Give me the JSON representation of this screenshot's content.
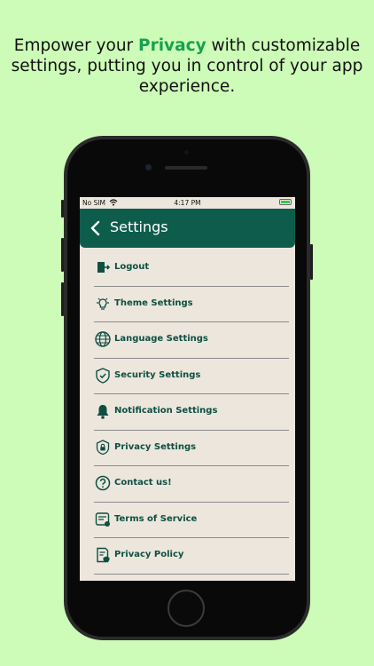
{
  "headline": {
    "part1": "Empower your ",
    "highlight": "Privacy",
    "part2": " with customizable settings, putting you in control of your app experience."
  },
  "status_bar": {
    "carrier": "No SIM",
    "time": "4:17 PM",
    "battery_charging": true
  },
  "app_bar": {
    "title": "Settings",
    "back_icon": "chevron-left-icon"
  },
  "colors": {
    "background": "#cdfbb8",
    "app_bar": "#0e5d4c",
    "screen_bg": "#ece6dd",
    "label": "#0e4f42",
    "highlight": "#18a24f"
  },
  "menu": [
    {
      "label": "Logout",
      "icon": "logout-icon"
    },
    {
      "label": "Theme Settings",
      "icon": "lightbulb-icon"
    },
    {
      "label": "Language Settings",
      "icon": "globe-icon"
    },
    {
      "label": "Security Settings",
      "icon": "shield-check-icon"
    },
    {
      "label": "Notification Settings",
      "icon": "bell-icon"
    },
    {
      "label": "Privacy Settings",
      "icon": "shield-lock-icon"
    },
    {
      "label": "Contact us!",
      "icon": "help-circle-icon"
    },
    {
      "label": "Terms of Service",
      "icon": "document-icon"
    },
    {
      "label": "Privacy Policy",
      "icon": "policy-document-icon"
    }
  ]
}
